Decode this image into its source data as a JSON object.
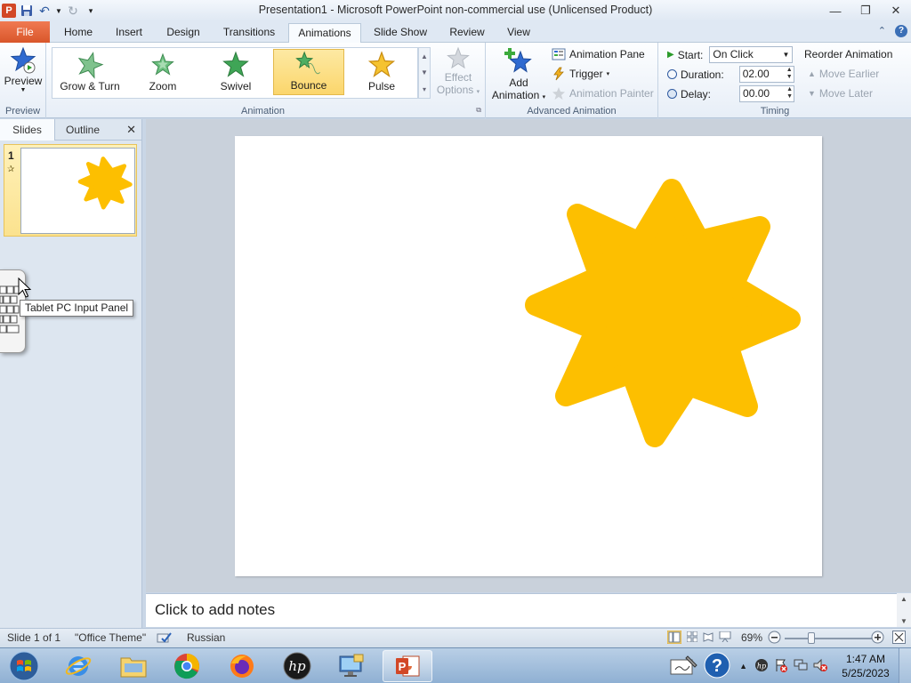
{
  "app": {
    "window_title": "Presentation1  -  Microsoft PowerPoint non-commercial use (Unlicensed Product)"
  },
  "tabs": [
    {
      "label": "File"
    },
    {
      "label": "Home"
    },
    {
      "label": "Insert"
    },
    {
      "label": "Design"
    },
    {
      "label": "Transitions"
    },
    {
      "label": "Animations"
    },
    {
      "label": "Slide Show"
    },
    {
      "label": "Review"
    },
    {
      "label": "View"
    }
  ],
  "active_tab": "Animations",
  "ribbon": {
    "preview": {
      "label": "Preview",
      "group": "Preview"
    },
    "animation_group": "Animation",
    "gallery": [
      {
        "label": "Grow & Turn"
      },
      {
        "label": "Zoom"
      },
      {
        "label": "Swivel"
      },
      {
        "label": "Bounce",
        "selected": true
      },
      {
        "label": "Pulse"
      }
    ],
    "effect_options": {
      "line1": "Effect",
      "line2": "Options"
    },
    "add_animation": {
      "line1": "Add",
      "line2": "Animation"
    },
    "advanced_group": "Advanced Animation",
    "animation_pane": "Animation Pane",
    "trigger": "Trigger",
    "animation_painter": "Animation Painter",
    "timing_group": "Timing",
    "start_label": "Start:",
    "start_value": "On Click",
    "duration_label": "Duration:",
    "duration_value": "02.00",
    "delay_label": "Delay:",
    "delay_value": "00.00",
    "reorder_title": "Reorder Animation",
    "move_earlier": "Move Earlier",
    "move_later": "Move Later"
  },
  "left_pane": {
    "tabs": [
      "Slides",
      "Outline"
    ],
    "slide_number": "1"
  },
  "tooltip": "Tablet PC Input Panel",
  "notes_placeholder": "Click to add notes",
  "status": {
    "slide_info": "Slide 1 of 1",
    "theme": "\"Office Theme\"",
    "language": "Russian",
    "zoom": "69%"
  },
  "taskbar": {
    "time": "1:47 AM",
    "date": "5/25/2023"
  },
  "colors": {
    "star": "#fdbf00",
    "accent": "#d24726"
  }
}
